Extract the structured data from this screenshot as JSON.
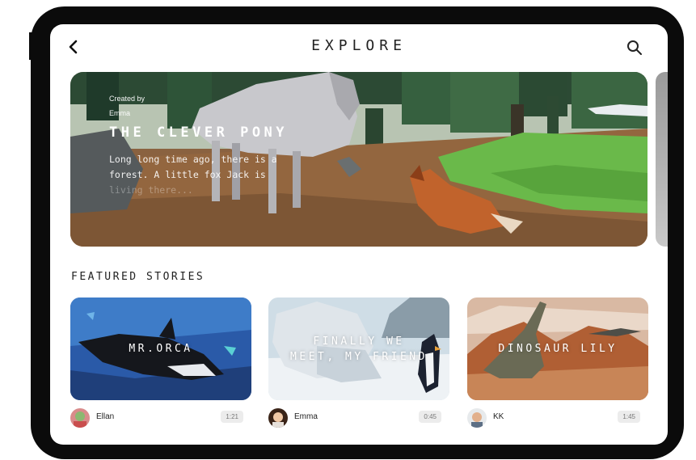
{
  "header": {
    "title": "EXPLORE"
  },
  "hero": {
    "created_by_label": "Created by",
    "author": "Emma",
    "title": "THE CLEVER PONY",
    "description_main": "Long long time ago, there is a forest. A little fox Jack is",
    "description_fade": "living there..."
  },
  "featured": {
    "heading": "FEATURED STORIES",
    "stories": [
      {
        "title": "MR.ORCA",
        "author": "Ellan",
        "duration": "1:21"
      },
      {
        "title": "FINALLY WE\nMEET, MY FRIEND",
        "author": "Emma",
        "duration": "0:45"
      },
      {
        "title": "DINOSAUR LILY",
        "author": "KK",
        "duration": "1:45"
      }
    ]
  },
  "icons": [
    "back-arrow-icon",
    "search-icon"
  ]
}
